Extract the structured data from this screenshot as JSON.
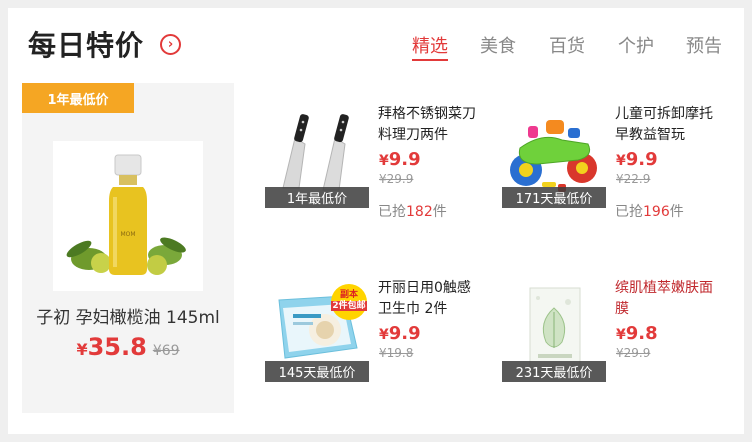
{
  "header": {
    "title": "每日特价",
    "tabs": [
      {
        "label": "精选",
        "active": true
      },
      {
        "label": "美食",
        "active": false
      },
      {
        "label": "百货",
        "active": false
      },
      {
        "label": "个护",
        "active": false
      },
      {
        "label": "预告",
        "active": false
      }
    ]
  },
  "feature": {
    "badge": "1年最低价",
    "name": "子初 孕妇橄榄油 145ml",
    "currency": "¥",
    "price": "35.8",
    "old_price": "¥69"
  },
  "products": [
    {
      "name": "拜格不锈钢菜刀料理刀两件",
      "badge": "1年最低价",
      "currency": "¥",
      "price": "9.9",
      "old_price": "¥29.9",
      "sold_prefix": "已抢",
      "sold_count": "182",
      "sold_suffix": "件",
      "name_color": "normal"
    },
    {
      "name": "儿童可拆卸摩托早教益智玩",
      "badge": "171天最低价",
      "currency": "¥",
      "price": "9.9",
      "old_price": "¥22.9",
      "sold_prefix": "已抢",
      "sold_count": "196",
      "sold_suffix": "件",
      "name_color": "normal"
    },
    {
      "name": "开丽日用0触感卫生巾 2件",
      "badge": "145天最低价",
      "currency": "¥",
      "price": "9.9",
      "old_price": "¥19.8",
      "package_tag_line1": "副本",
      "package_tag_line2": "2件包邮",
      "name_color": "normal"
    },
    {
      "name": "缤肌植萃嫩肤面膜",
      "badge": "231天最低价",
      "currency": "¥",
      "price": "9.8",
      "old_price": "¥29.9",
      "name_color": "red"
    }
  ],
  "colors": {
    "accent": "#e23a3a",
    "badge_orange": "#f5a623",
    "badge_dark": "#3c3c3c"
  }
}
